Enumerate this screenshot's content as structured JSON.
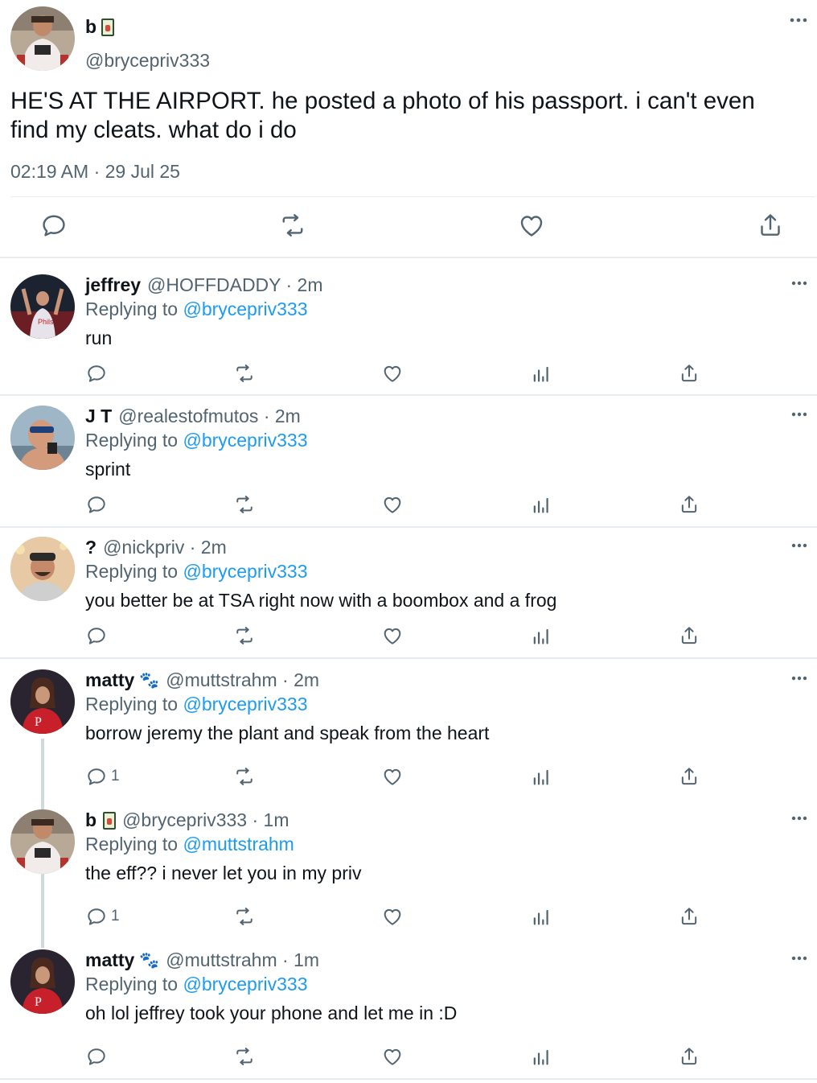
{
  "main_tweet": {
    "display_name": "b",
    "name_emoji_icon": "juice-box-emoji-icon",
    "handle": "@brycepriv333",
    "text_line1": "HE'S AT THE AIRPORT. he posted a photo of his passport. i can't even",
    "text_line2": "find my cleats. what do i do",
    "timestamp": "02:19 AM · 29 Jul 25"
  },
  "replies": [
    {
      "name": "jeffrey",
      "meta": "@HOFFDADDY · 2m",
      "replying_prefix": "Replying to",
      "replying_to": "@brycepriv333",
      "text": "run",
      "reply_count": ""
    },
    {
      "name": "J T",
      "meta": "@realestofmutos · 2m",
      "replying_prefix": "Replying to",
      "replying_to": "@brycepriv333",
      "text": "sprint",
      "reply_count": ""
    },
    {
      "name": "?",
      "meta": "@nickpriv · 2m",
      "replying_prefix": "Replying to",
      "replying_to": "@brycepriv333",
      "text": "you better be at TSA right now with a boombox and a frog",
      "reply_count": ""
    },
    {
      "name": "matty",
      "meta": "@muttstrahm · 2m",
      "replying_prefix": "Replying to",
      "replying_to": "@brycepriv333",
      "text": "borrow jeremy the plant and speak from the heart",
      "reply_count": "1"
    },
    {
      "name": "b",
      "meta": "@brycepriv333 · 1m",
      "replying_prefix": "Replying to",
      "replying_to": "@muttstrahm",
      "text": "the eff?? i never let you in my priv",
      "reply_count": "1"
    },
    {
      "name": "matty",
      "meta": "@muttstrahm · 1m",
      "replying_prefix": "Replying to",
      "replying_to": "@brycepriv333",
      "text": "oh lol jeffrey took your phone and let me in :D",
      "reply_count": ""
    }
  ],
  "colors": {
    "link": "#1d9bf0",
    "secondary_text": "#536471",
    "icon": "#536471",
    "divider": "#e6ecf0"
  }
}
